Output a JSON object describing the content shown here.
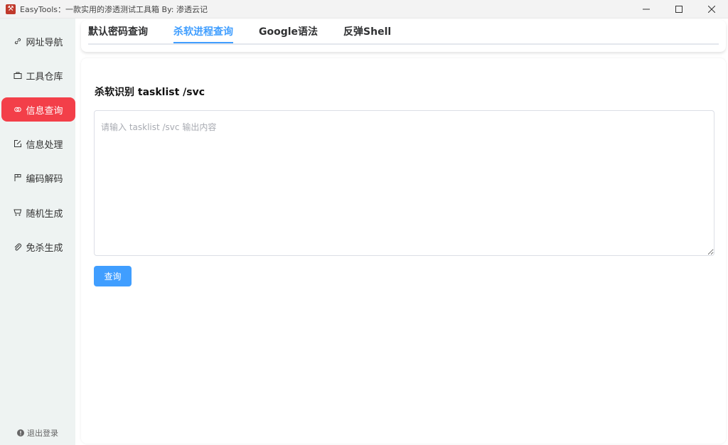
{
  "window": {
    "title": "EasyTools：一款实用的渗透测试工具箱 By: 渗透云记",
    "app_icon": "app-logo-icon"
  },
  "sidebar": {
    "items": [
      {
        "label": "网址导航",
        "icon": "link-icon"
      },
      {
        "label": "工具仓库",
        "icon": "briefcase-icon"
      },
      {
        "label": "信息查询",
        "icon": "chain-icon",
        "active": true
      },
      {
        "label": "信息处理",
        "icon": "edit-icon"
      },
      {
        "label": "编码解码",
        "icon": "flag-icon"
      },
      {
        "label": "随机生成",
        "icon": "cart-icon"
      },
      {
        "label": "免杀生成",
        "icon": "paperclip-icon"
      }
    ],
    "logout_label": "退出登录",
    "active_color": "#f33f49"
  },
  "tabs": {
    "items": [
      "默认密码查询",
      "杀软进程查询",
      "Google语法",
      "反弹Shell"
    ],
    "active_index": 1,
    "accent_color": "#409eff"
  },
  "main": {
    "section_title": "杀软识别 tasklist /svc",
    "input_placeholder": "请输入 tasklist /svc 输出内容",
    "input_value": "",
    "query_button_label": "查询"
  }
}
